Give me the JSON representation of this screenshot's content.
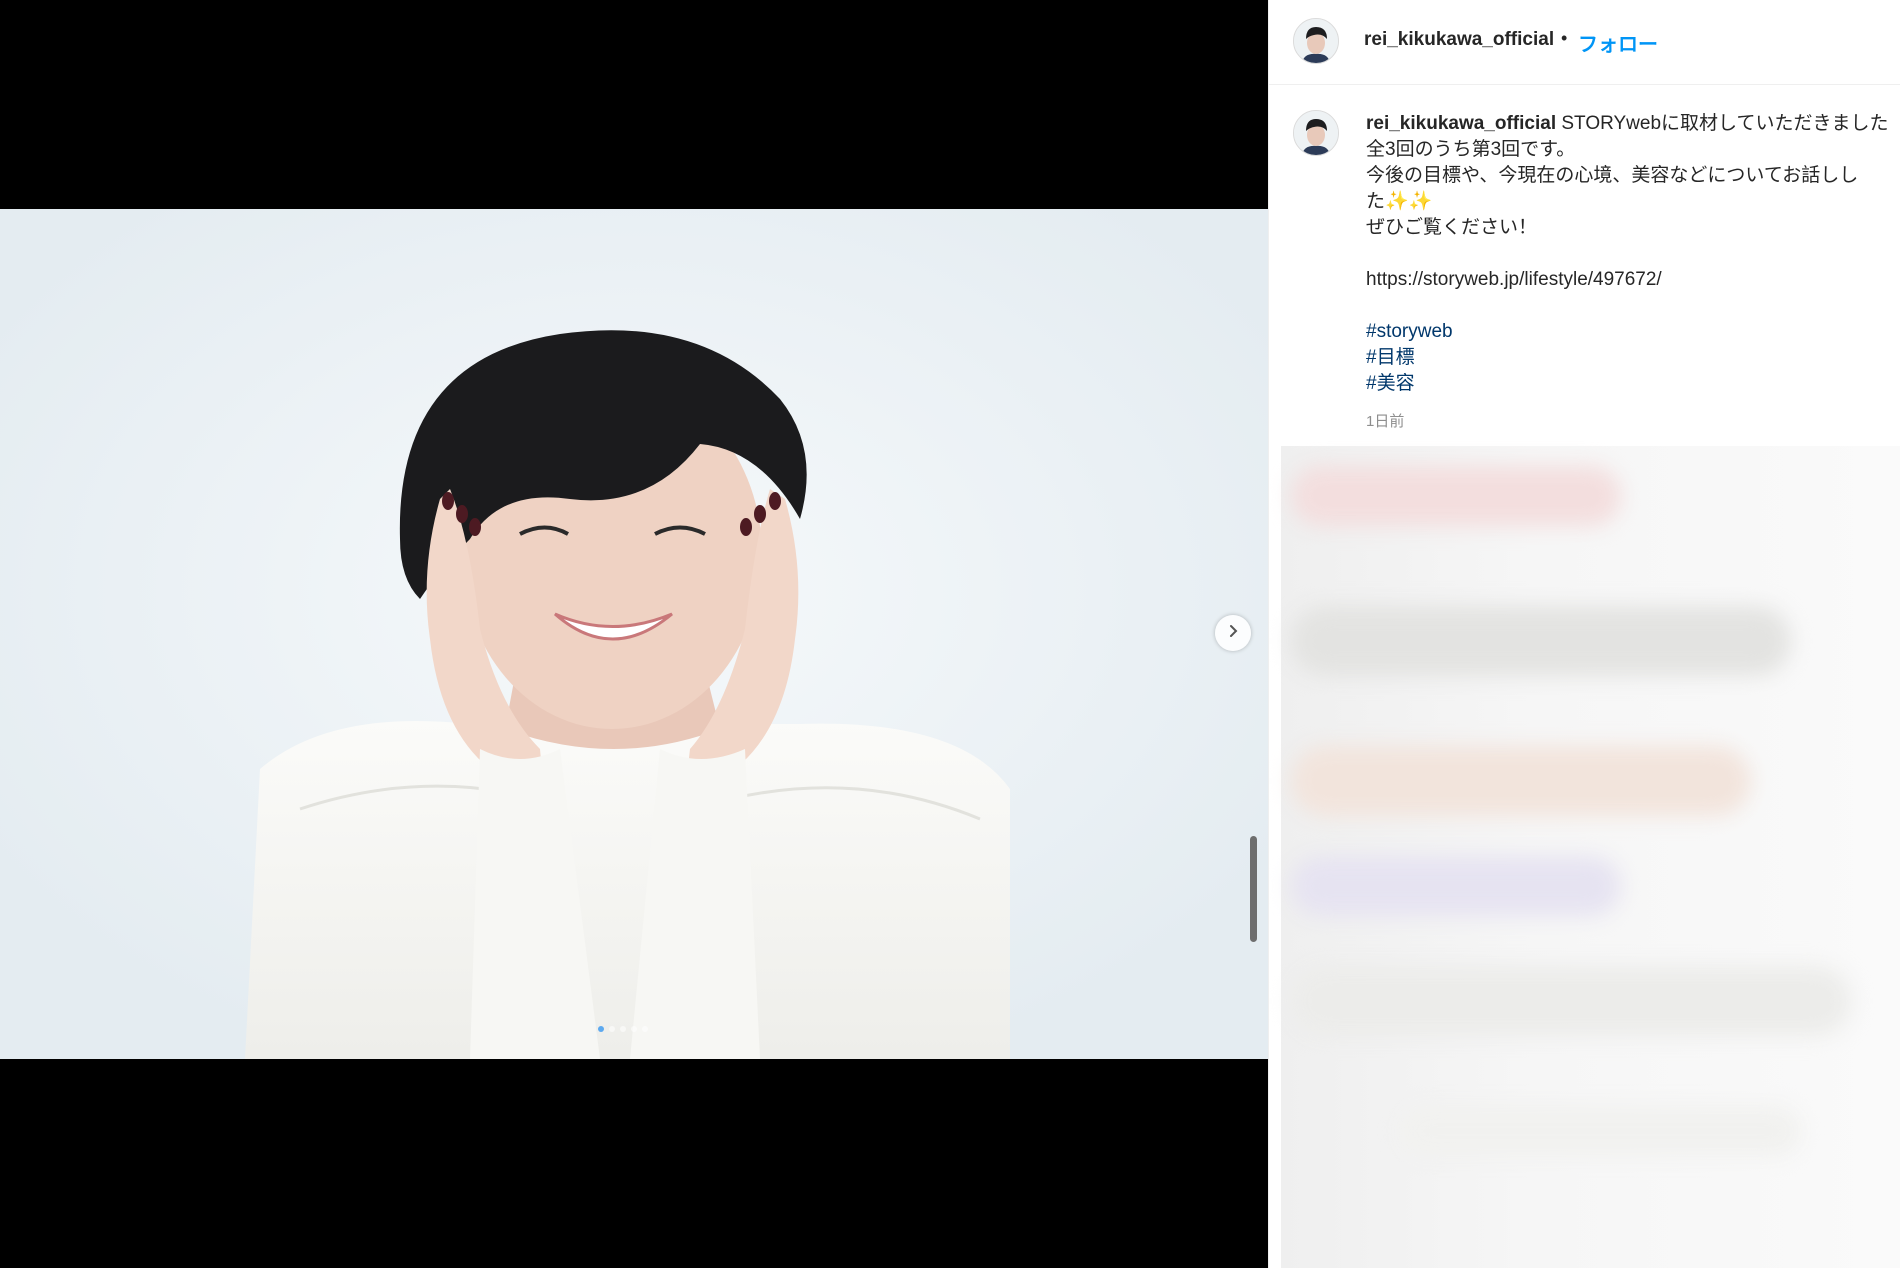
{
  "post": {
    "username": "rei_kikukawa_official",
    "follow_label": "フォロー",
    "separator": "•"
  },
  "caption": {
    "username": "rei_kikukawa_official",
    "line1_text": " STORYwebに取材していただきました",
    "line2": "全3回のうち第3回です。",
    "line3": "今後の目標や、今現在の心境、美容などについてお話しし",
    "line4_text": "た",
    "line4_emoji": "✨✨",
    "line5": "ぜひご覧ください！",
    "link": "https://storyweb.jp/lifestyle/497672/",
    "hashtags": [
      "#storyweb",
      "#目標",
      "#美容"
    ],
    "timestamp": "1日前"
  },
  "carousel": {
    "slide_count": 5,
    "active_index": 0
  },
  "icons": {
    "next": "chevron-right-icon",
    "avatar": "profile-avatar"
  },
  "colors": {
    "follow": "#0095f6",
    "hashtag": "#00376b",
    "timestamp": "#8e8e8e"
  }
}
